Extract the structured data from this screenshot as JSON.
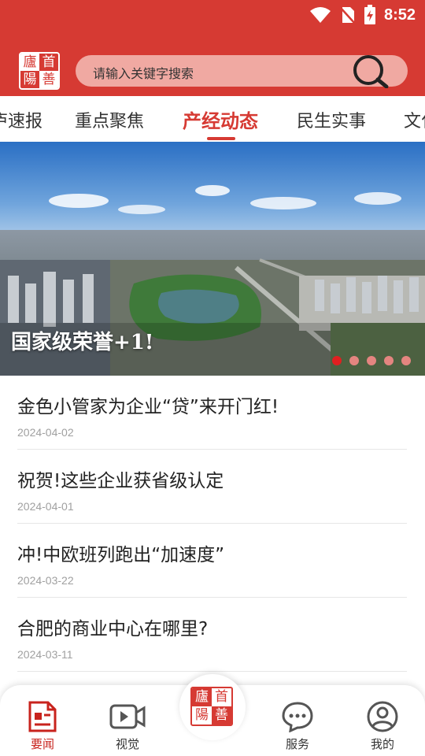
{
  "status_bar": {
    "time": "8:52",
    "icons": [
      "wifi-icon",
      "no-sim-icon",
      "battery-charging-icon"
    ]
  },
  "header": {
    "logo_chars": [
      "廬",
      "首",
      "陽",
      "善"
    ],
    "search_placeholder": "请输入关键字搜索"
  },
  "tabs": [
    {
      "label": "庐速报"
    },
    {
      "label": "重点聚焦"
    },
    {
      "label": "产经动态",
      "active": true
    },
    {
      "label": "民生实事"
    },
    {
      "label": "文化"
    }
  ],
  "banner": {
    "caption": "国家级荣誉+1!",
    "slides": 5,
    "active_slide": 1
  },
  "news": [
    {
      "title": "金色小管家为企业“贷”来开门红!",
      "date": "2024-04-02"
    },
    {
      "title": "祝贺!这些企业获省级认定",
      "date": "2024-04-01"
    },
    {
      "title": "冲!中欧班列跑出“加速度”",
      "date": "2024-03-22"
    },
    {
      "title": "合肥的商业中心在哪里?",
      "date": "2024-03-11"
    }
  ],
  "bottom_nav": [
    {
      "label": "要闻",
      "icon": "news-icon",
      "active": true
    },
    {
      "label": "视觉",
      "icon": "video-icon"
    },
    {
      "label": "服务",
      "icon": "chat-icon"
    },
    {
      "label": "我的",
      "icon": "profile-icon"
    }
  ],
  "colors": {
    "brand": "#d63a33",
    "active_tab": "#d63a33",
    "nav_active": "#c8231d"
  }
}
